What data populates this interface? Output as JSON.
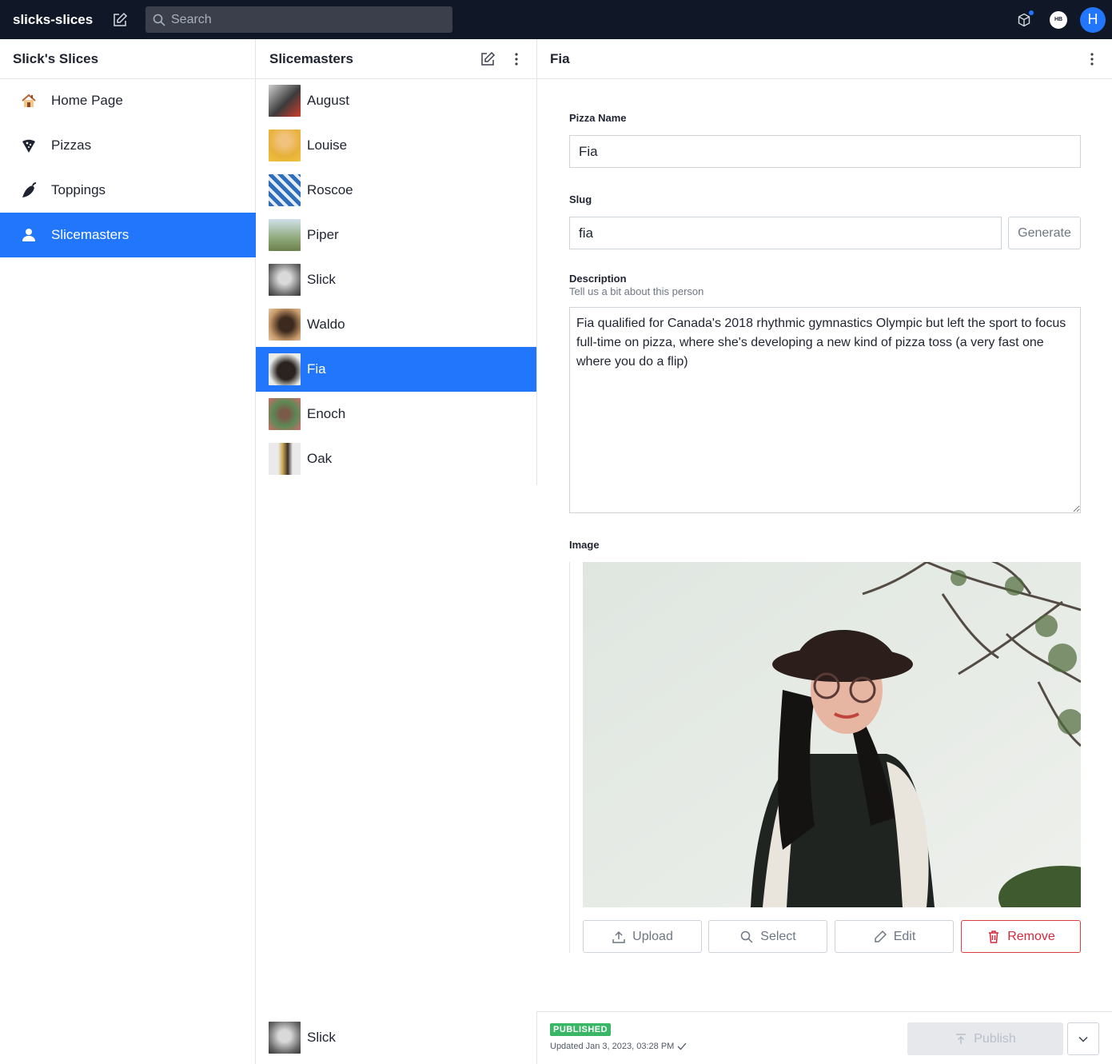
{
  "topbar": {
    "project_name": "slicks-slices",
    "search_placeholder": "Search",
    "user_badge": "HB",
    "user_initial": "H"
  },
  "pane1": {
    "title": "Slick's Slices",
    "items": [
      {
        "label": "Home Page",
        "icon": "house-icon"
      },
      {
        "label": "Pizzas",
        "icon": "pizza-icon"
      },
      {
        "label": "Toppings",
        "icon": "pepper-icon"
      },
      {
        "label": "Slicemasters",
        "icon": "person-icon",
        "active": true
      }
    ]
  },
  "pane2": {
    "title": "Slicemasters",
    "items": [
      {
        "label": "August"
      },
      {
        "label": "Louise"
      },
      {
        "label": "Roscoe"
      },
      {
        "label": "Piper"
      },
      {
        "label": "Slick"
      },
      {
        "label": "Waldo"
      },
      {
        "label": "Fia",
        "active": true
      },
      {
        "label": "Enoch"
      },
      {
        "label": "Oak"
      }
    ],
    "bottom_item": {
      "label": "Slick"
    }
  },
  "editor": {
    "title": "Fia",
    "fields": {
      "name_label": "Pizza Name",
      "name_value": "Fia",
      "slug_label": "Slug",
      "slug_value": "fia",
      "generate_label": "Generate",
      "description_label": "Description",
      "description_hint": "Tell us a bit about this person",
      "description_value": "Fia qualified for Canada's 2018 rhythmic gymnastics Olympic but left the sport to focus full-time on pizza, where she's developing a new kind of pizza toss (a very fast one where you do a flip)",
      "image_label": "Image"
    },
    "image_actions": {
      "upload": "Upload",
      "select": "Select",
      "edit": "Edit",
      "remove": "Remove"
    }
  },
  "footer": {
    "status": "PUBLISHED",
    "updated": "Updated Jan 3, 2023, 03:28 PM",
    "publish_label": "Publish"
  },
  "colors": {
    "topbar_bg": "#101828",
    "accent": "#2276fc",
    "published": "#3ab667",
    "danger": "#d2293d"
  }
}
